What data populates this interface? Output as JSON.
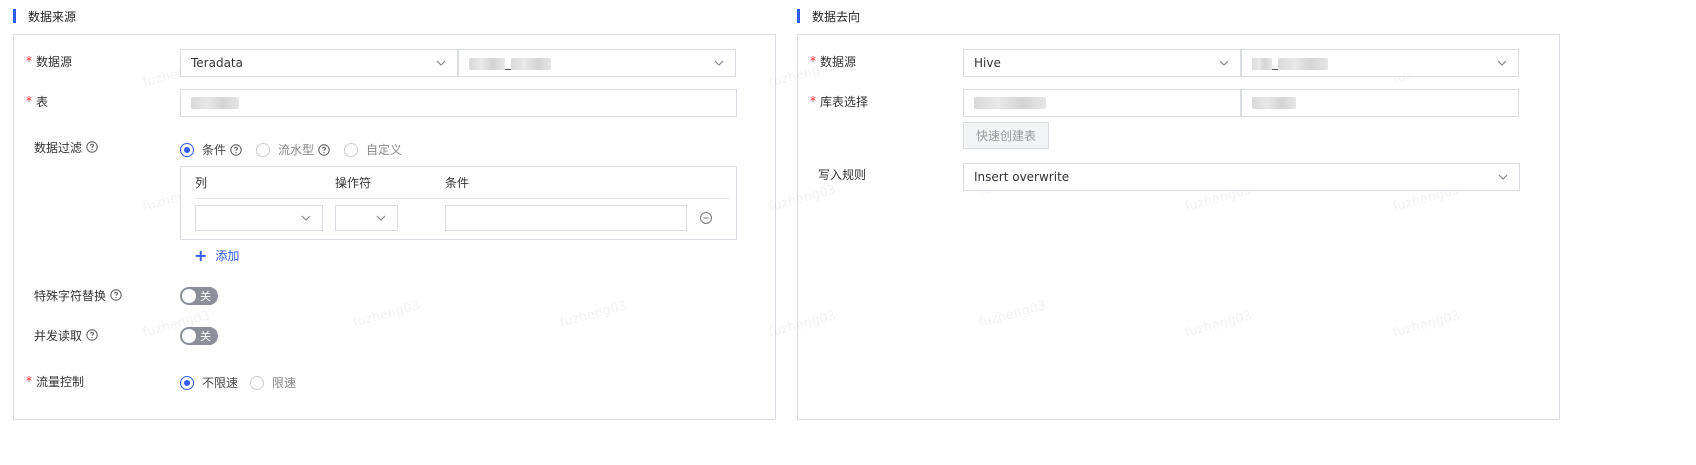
{
  "source": {
    "title": "数据来源",
    "datasource_label": "数据源",
    "datasource_value": "Teradata",
    "datasource_db_value": "_",
    "table_label": "表",
    "filter_label": "数据过滤",
    "filter_options": [
      "条件",
      "流水型",
      "自定义"
    ],
    "filter_selected": "条件",
    "cond_columns": [
      "列",
      "操作符",
      "条件"
    ],
    "add_label": "添加",
    "special_char_label": "特殊字符替换",
    "special_char_toggle": "关",
    "concurrent_label": "并发读取",
    "concurrent_toggle": "关",
    "flow_label": "流量控制",
    "flow_options": [
      "不限速",
      "限速"
    ],
    "flow_selected": "不限速"
  },
  "target": {
    "title": "数据去向",
    "datasource_label": "数据源",
    "datasource_value": "Hive",
    "datasource_db_value": "_",
    "table_label": "库表选择",
    "quick_create_label": "快速创建表",
    "write_rule_label": "写入规则",
    "write_rule_value": "Insert overwrite"
  },
  "watermark": "fuzheng03",
  "colors": {
    "accent": "#2d5cf6",
    "required": "#f5222d",
    "border": "#d9dce3"
  }
}
